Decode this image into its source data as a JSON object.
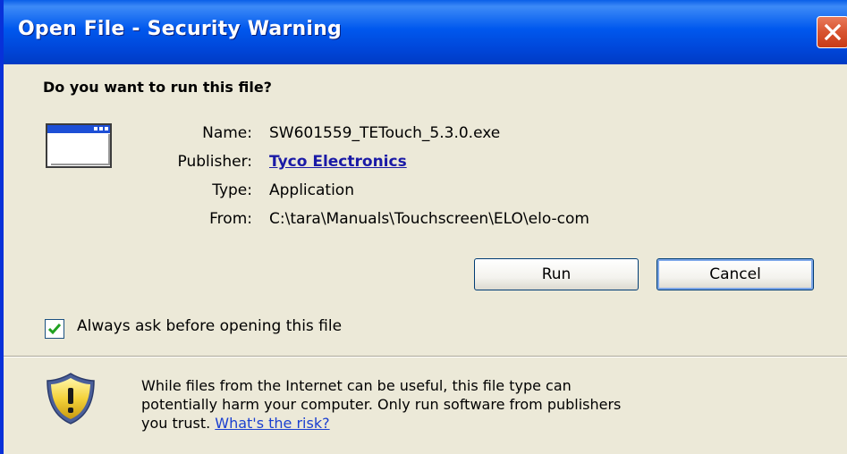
{
  "window": {
    "title": "Open File - Security Warning",
    "titlebar_color": "#0058ee"
  },
  "dialog": {
    "question": "Do you want to run this file?",
    "icon": "application-window-icon",
    "fields": {
      "name_label": "Name:",
      "name_value": "SW601559_TETouch_5.3.0.exe",
      "publisher_label": "Publisher:",
      "publisher_value": "Tyco Electronics",
      "type_label": "Type:",
      "type_value": "Application",
      "from_label": "From:",
      "from_value": "C:\\tara\\Manuals\\Touchscreen\\ELO\\elo-com"
    },
    "buttons": {
      "run_label": "Run",
      "cancel_label": "Cancel"
    },
    "always_ask": {
      "label": "Always ask before opening this file",
      "checked": true
    },
    "warning": {
      "icon": "security-shield-warning-icon",
      "line1": "While files from the Internet can be useful, this file type can",
      "line2": "potentially harm your computer. Only run software from publishers",
      "line3_prefix": "you trust. ",
      "risk_link": "What's the risk?"
    }
  }
}
